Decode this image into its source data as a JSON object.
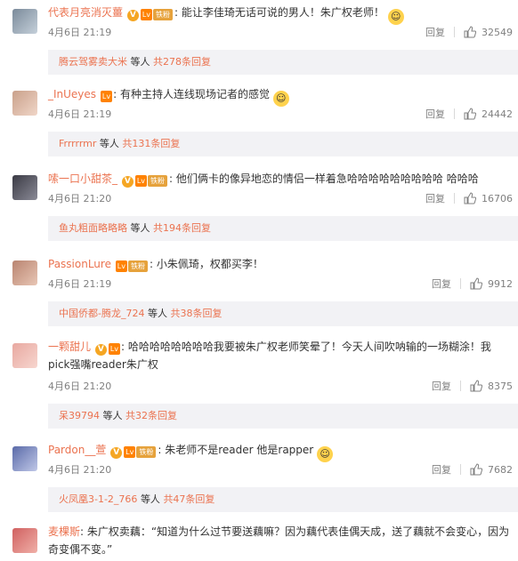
{
  "comments": [
    {
      "username": "代表月亮消灭薑",
      "text": "能让李佳琦无话可说的男人！朱广权老师！",
      "time": "4月6日 21:19",
      "reply_label": "回复",
      "likes": "32549",
      "replies_user": "腾云驾雾卖大米",
      "replies_mid": "等人",
      "replies_count": "共278条回复",
      "has_v": true,
      "has_fan": true
    },
    {
      "username": "_InUeyes",
      "text": "有种主持人连线现场记者的感觉",
      "time": "4月6日 21:19",
      "reply_label": "回复",
      "likes": "24442",
      "replies_user": "Frrrrrmr",
      "replies_mid": "等人",
      "replies_count": "共131条回复",
      "has_v": false,
      "has_fan": false
    },
    {
      "username": "嗦一口小甜茶_",
      "text": "他们俩卡的像异地恋的情侣一样着急哈哈哈哈哈哈哈哈哈 哈哈哈",
      "time": "4月6日 21:20",
      "reply_label": "回复",
      "likes": "16706",
      "replies_user": "鱼丸粗面略略略",
      "replies_mid": "等人",
      "replies_count": "共194条回复",
      "has_v": true,
      "has_fan": true
    },
    {
      "username": "PassionLure",
      "text": "小朱佩琦，权都买李！",
      "time": "4月6日 21:19",
      "reply_label": "回复",
      "likes": "9912",
      "replies_user": "中国侨都-腾龙_724",
      "replies_mid": "等人",
      "replies_count": "共38条回复",
      "has_v": false,
      "has_fan": true
    },
    {
      "username": "一颗甜儿",
      "text": "哈哈哈哈哈哈哈哈我要被朱广权老师笑晕了！今天人间吹呐输的一场糊涂！我pick强嘴reader朱广权",
      "time": "4月6日 21:20",
      "reply_label": "回复",
      "likes": "8375",
      "replies_user": "呆39794",
      "replies_mid": "等人",
      "replies_count": "共32条回复",
      "has_v": true,
      "has_fan": false
    },
    {
      "username": "Pardon__萱",
      "text": "朱老师不是reader 他是rapper",
      "time": "4月6日 21:20",
      "reply_label": "回复",
      "likes": "7682",
      "replies_user": "火凤凰3-1-2_766",
      "replies_mid": "等人",
      "replies_count": "共47条回复",
      "has_v": true,
      "has_fan": true
    },
    {
      "username": "麦棵斯",
      "text": "朱广权卖藕：“知道为什么过节要送藕嘛？因为藕代表佳偶天成，送了藕就不会变心，因为奇变偶不变。”",
      "has_v": false,
      "has_fan": false
    }
  ],
  "badges": {
    "v": "V",
    "fan": "铁粉",
    "lv": "Lv"
  },
  "colors": {
    "username": "#eb7350",
    "meta": "#808080",
    "reply_bg": "#f2f2f5"
  }
}
